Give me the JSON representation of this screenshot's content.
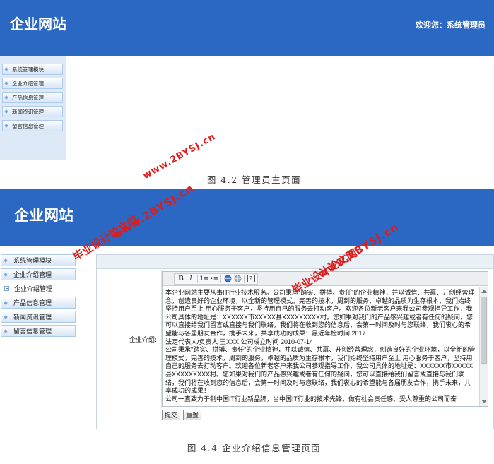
{
  "screen1": {
    "brand": "企业网站",
    "welcome": "欢迎您：系统管理员",
    "nav": [
      "系统管理模块",
      "企业介绍管理",
      "产品信息管理",
      "新闻资讯管理",
      "留言信息管理"
    ]
  },
  "caption1": "图 4.2 管理员主页面",
  "screen2": {
    "brand": "企业网站",
    "nav": [
      "系统管理模块",
      "企业介绍管理",
      "企业介绍管理",
      "产品信息管理",
      "新闻资讯管理",
      "留言信息管理"
    ],
    "form_label": "企业介绍:",
    "toolbar": {
      "bold": "B",
      "italic": "I",
      "ordered_list": "1≡",
      "unordered_list": "•≡",
      "help": "?"
    },
    "content": [
      "本企业网站主要从事IT行业技术服务。公司秉承\"踏实、拼搏、责任\"的企业精神，并以诚信、共赢、开创经营理念，创造良好的企业环境，以全新的管理模式，完善的技术，周到的服务，卓越的品质为生存根本，我们始终坚持用户至上 用心服务于客户，坚持用自己的服务去打动客户。欢迎各位新老客户来我公司参观指导工作，我公司具体的地址是：XXXXXX市XXXXX县XXXXXXXXX村。您如果对我们的产品感兴趣或者有任何的疑问，您可以直接给我们留言或直接与我们联络，我们将在收到您的信息后，会第一时间及时与您联络，我们衷心的希望能与各届朋友合作，携手未来，共享成功的成果！最近年检时间 2017",
      "法定代表人/负责人 王XXX 公司成立时间 2010-07-14",
      "公司秉承\"踏实、拼搏、责任\"的企业精神，并以诚信、共赢、开创经营理念，创造良好的企业环境，以全新的管理模式，完善的技术，周到的服务，卓越的品质为生存根本，我们始终坚持用户至上 用心服务于客户，坚持用自己的服务去打动客户。欢迎各位新老客户来我公司参观指导工作，我公司具体的地址是：XXXXXX市XXXXX县XXXXXXXXX村。您如果对我们的产品感兴趣或者有任何的疑问，您可以直接给我们留言或直接与我们联络，我们将在收到您的信息后，会第一时间及时与您联络，我们衷心的希望能与各届朋友合作，携手未来，共享成功的成果！",
      "公司一直致力于制中国IT行业新品牌，当中国IT行业的技术先锋，做有社会责任感、受人尊重的公司而奋"
    ],
    "submit_label": "提交",
    "reset_label": "重置"
  },
  "caption2": "图 4.4 企业介绍信息管理页面",
  "watermarks": {
    "site_a": "www.2BYSJ.cn",
    "site_b": "毕业设计论文网",
    "site_c": "www.2BYSJ.cn",
    "site_d": "毕业设计论文网",
    "site_e": "www.2BYSJ.cn"
  }
}
